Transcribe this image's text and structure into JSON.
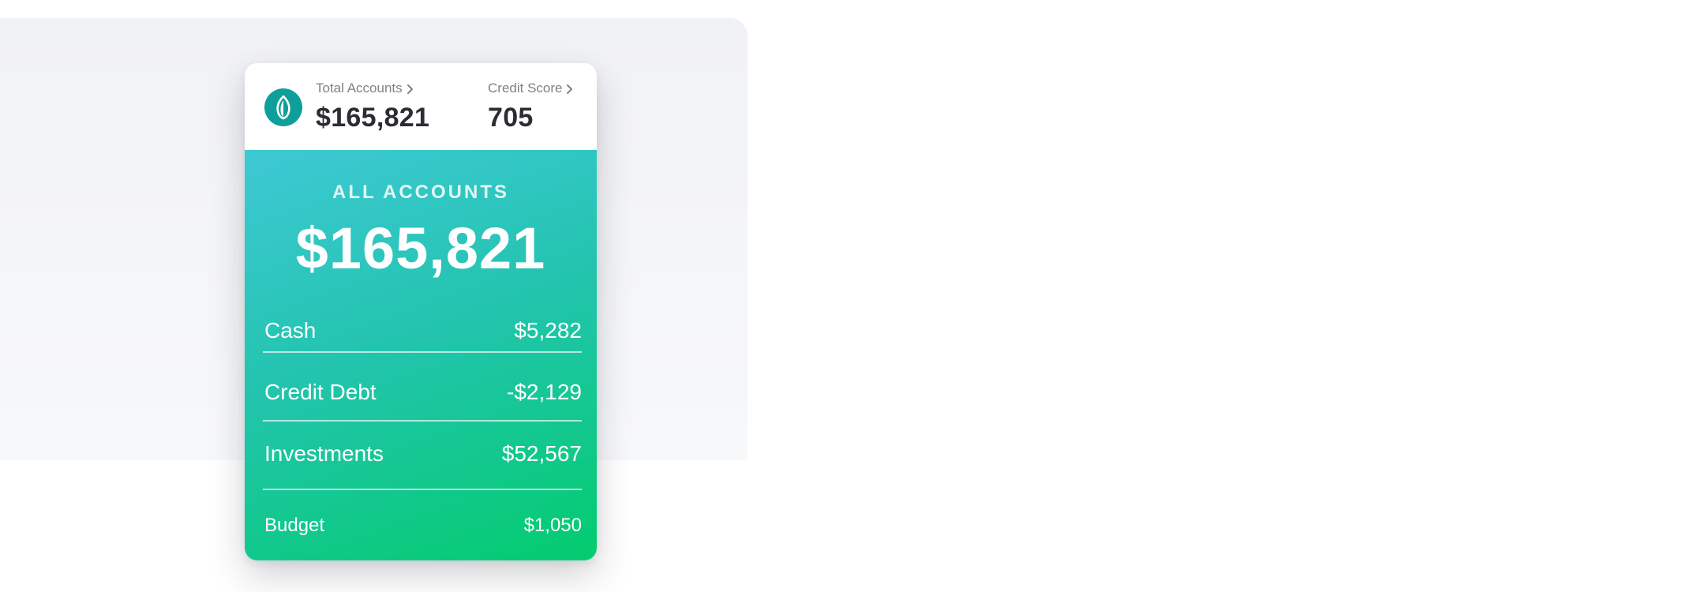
{
  "header": {
    "total_accounts": {
      "label": "Total Accounts",
      "value": "$165,821"
    },
    "credit_score": {
      "label": "Credit Score",
      "value": "705"
    }
  },
  "summary": {
    "label": "ALL ACCOUNTS",
    "value": "$165,821"
  },
  "rows": [
    {
      "label": "Cash",
      "value": "$5,282"
    },
    {
      "label": "Credit Debt",
      "value": "-$2,129"
    },
    {
      "label": "Investments",
      "value": "$52,567"
    },
    {
      "label": "Budget",
      "value": "$1,050"
    }
  ],
  "colors": {
    "brand": "#0f9f9b",
    "gradient_start": "#3ec9d5",
    "gradient_end": "#03cc6e",
    "text_dark": "#2c2d33",
    "text_muted": "#7f8088"
  },
  "icons": {
    "logo": "leaf-logo-icon",
    "chevron": "chevron-right-icon"
  }
}
